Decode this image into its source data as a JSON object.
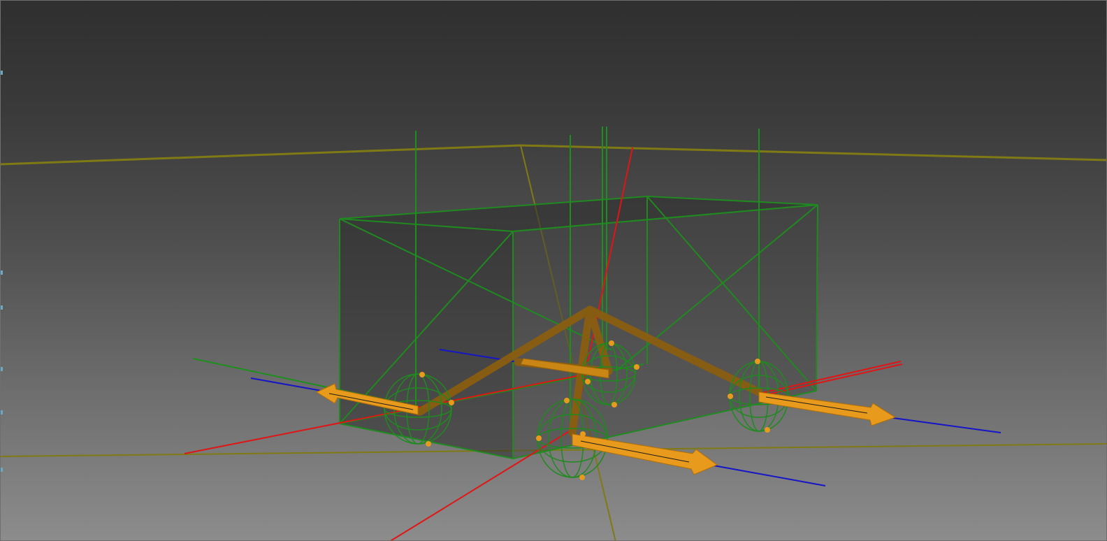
{
  "viewport": {
    "background_top": "#2f2f2f",
    "background_bottom": "#8c8c8c"
  },
  "colors": {
    "rigid_body_wire": "#1f8a1f",
    "constraint_orange": "#e89a1c",
    "constraint_brown": "#8a5d10",
    "axis_x": "#e01515",
    "axis_y": "#1d8f1d",
    "axis_z": "#1515c8",
    "ground_plane": "#7f7a14"
  },
  "scene": {
    "objects": [
      {
        "kind": "box-rigid-body",
        "icon": "wireframe-box-icon"
      },
      {
        "kind": "wheel",
        "icon": "wireframe-sphere-icon",
        "count": 4
      },
      {
        "kind": "hinge-constraint",
        "icon": "arrow-constraint-icon",
        "count": 4
      }
    ]
  }
}
